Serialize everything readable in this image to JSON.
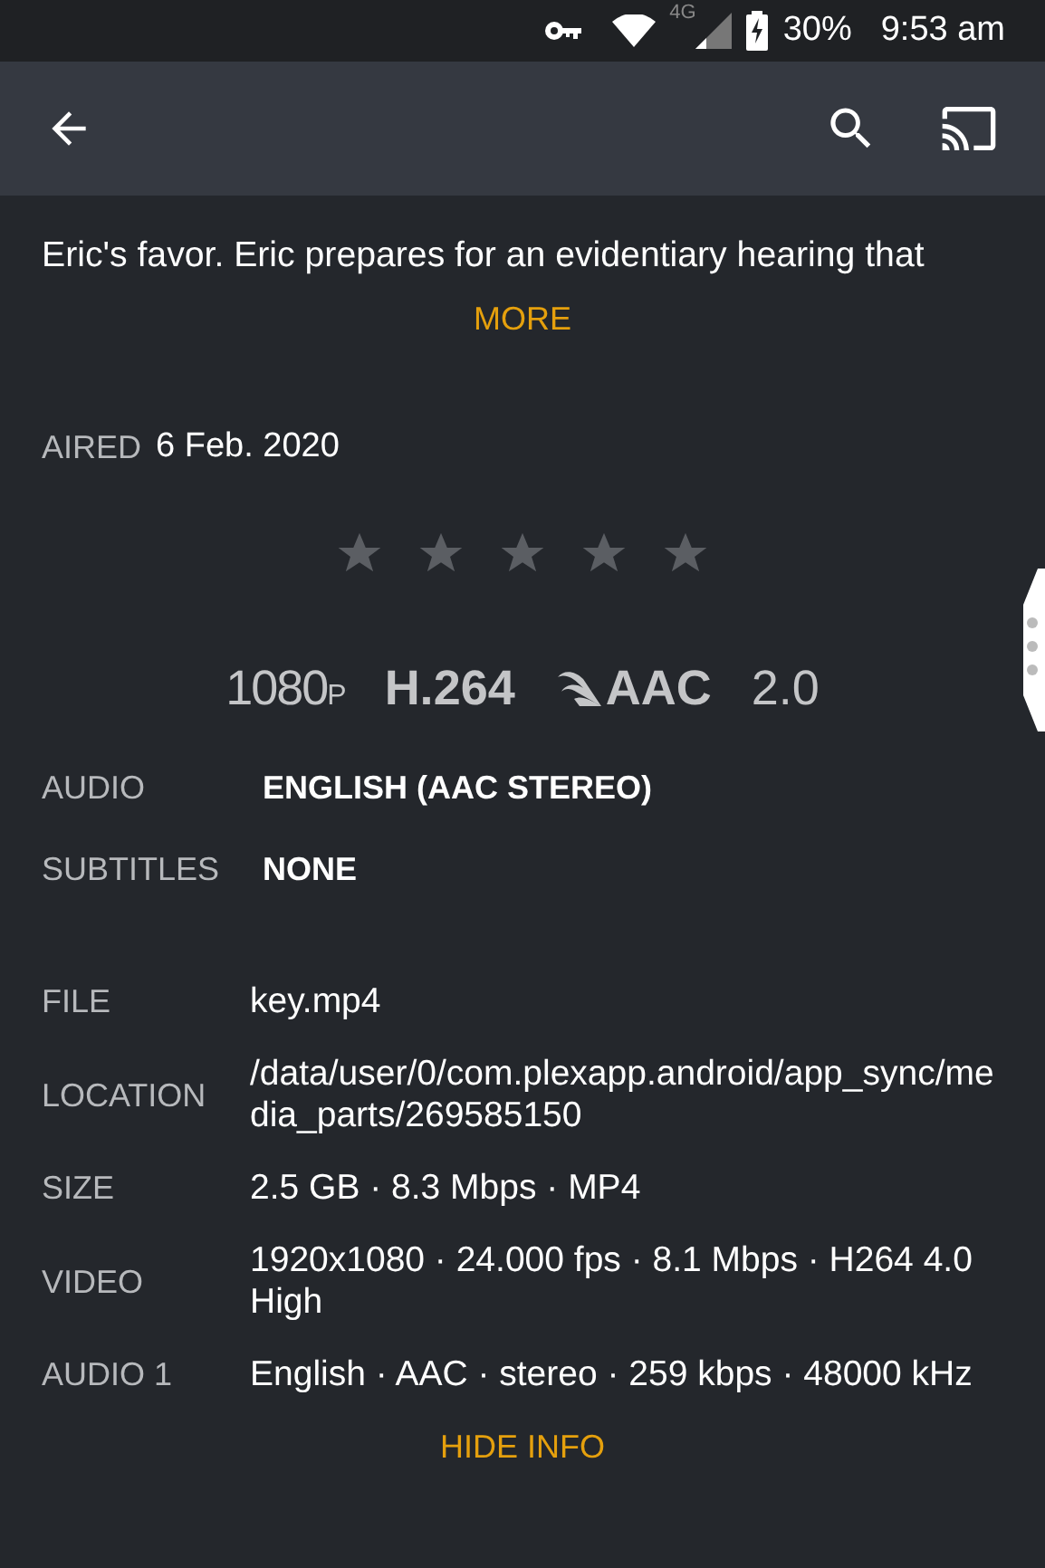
{
  "status_bar": {
    "battery": "30%",
    "time": "9:53 am",
    "network": "4G"
  },
  "summary": {
    "last_line": "Eric's favor. Eric prepares for an evidentiary hearing that",
    "more": "MORE"
  },
  "aired": {
    "label": "AIRED",
    "value": "6 Feb. 2020"
  },
  "rating": {
    "stars": 0
  },
  "flags": [
    {
      "kind": "resolution",
      "text": "1080",
      "suffix": "P"
    },
    {
      "kind": "codec",
      "text": "H.264"
    },
    {
      "kind": "audio",
      "text": "AAC"
    },
    {
      "kind": "channels",
      "text": "2.0"
    }
  ],
  "streams": [
    {
      "label": "AUDIO",
      "value": "ENGLISH (AAC STEREO)"
    },
    {
      "label": "SUBTITLES",
      "value": "NONE"
    }
  ],
  "info": [
    {
      "label": "FILE",
      "value": "key.mp4"
    },
    {
      "label": "LOCATION",
      "value": "/data/user/0/com.plexapp.android/app_sync/media_parts/269585150"
    },
    {
      "label": "SIZE",
      "value": "2.5 GB · 8.3 Mbps · MP4"
    },
    {
      "label": "VIDEO",
      "value": "1920x1080 · 24.000 fps · 8.1 Mbps · H264 4.0 High"
    },
    {
      "label": "AUDIO 1",
      "value": "English · AAC · stereo · 259 kbps · 48000 kHz"
    }
  ],
  "hide_info": "HIDE INFO"
}
